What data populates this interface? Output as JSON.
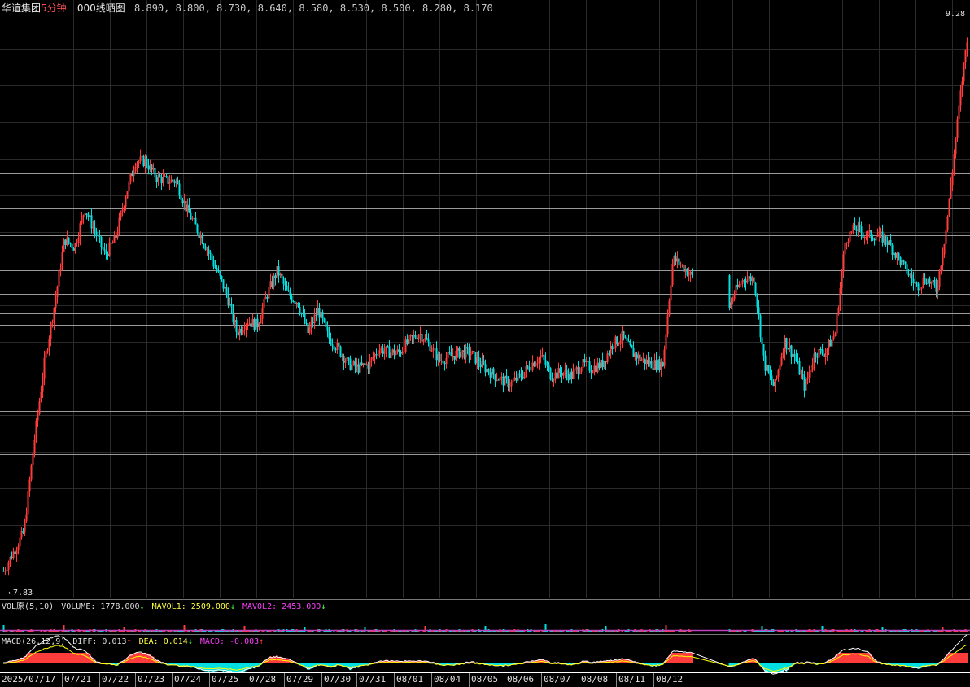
{
  "header": {
    "name": "华谊集团",
    "period": "5分钟",
    "indicator": "000线晒图",
    "levels": "8.890, 8.800, 8.730, 8.640, 8.580, 8.530, 8.500, 8.280, 8.170"
  },
  "price_labels": {
    "high": "9.28",
    "low": "←7.83"
  },
  "vol_legend": {
    "name": "VOL原(5,10)",
    "volume": "VOLUME: 1778.000",
    "volume_arrow": "↓",
    "mavol1": "MAVOL1: 2509.000",
    "mavol1_arrow": "↓",
    "mavol2": "MAVOL2: 2453.000",
    "mavol2_arrow": "↓"
  },
  "macd_legend": {
    "name": "MACD(26,12,9)",
    "diff": "DIFF: 0.013",
    "diff_arrow": "↑",
    "dea": "DEA: 0.014",
    "dea_arrow": "↓",
    "macd": "MACD: -0.003",
    "macd_arrow": "↑"
  },
  "dates": [
    "2025/07/17",
    "07/21",
    "07/22",
    "07/23",
    "07/24",
    "07/25",
    "07/28",
    "07/29",
    "07/30",
    "07/31",
    "08/01",
    "08/04",
    "08/05",
    "08/06",
    "08/07",
    "08/08",
    "08/11",
    "08/12"
  ],
  "colors": {
    "up": "#ff3c3c",
    "down": "#00e0e0",
    "grid": "#2a2a2a",
    "level_line": "#9a9a9a",
    "vol_line": "#c040c0",
    "diff_line": "#ffffff",
    "dea_line": "#ffff00"
  },
  "chart_data": {
    "type": "candlestick",
    "symbol": "华谊集团",
    "period": "5分钟",
    "y_high": 9.28,
    "y_low": 7.83,
    "ylim": [
      7.8,
      9.3
    ],
    "horizontal_levels": [
      8.89,
      8.8,
      8.73,
      8.64,
      8.58,
      8.53,
      8.5,
      8.28,
      8.17
    ],
    "date_labels": [
      "2025/07/17",
      "07/21",
      "07/22",
      "07/23",
      "07/24",
      "07/25",
      "07/28",
      "07/29",
      "07/30",
      "07/31",
      "08/01",
      "08/04",
      "08/05",
      "08/06",
      "08/07",
      "08/08",
      "08/11",
      "08/12"
    ],
    "close_path": [
      [
        0,
        7.87
      ],
      [
        1,
        7.92
      ],
      [
        2,
        7.97
      ],
      [
        3,
        8.2
      ],
      [
        4,
        8.4
      ],
      [
        5,
        8.55
      ],
      [
        6,
        8.72
      ],
      [
        7,
        8.7
      ],
      [
        8,
        8.8
      ],
      [
        9,
        8.74
      ],
      [
        10,
        8.68
      ],
      [
        11,
        8.72
      ],
      [
        12,
        8.83
      ],
      [
        13,
        8.92
      ],
      [
        14,
        8.92
      ],
      [
        15,
        8.88
      ],
      [
        16,
        8.87
      ],
      [
        17,
        8.87
      ],
      [
        18,
        8.8
      ],
      [
        19,
        8.75
      ],
      [
        20,
        8.7
      ],
      [
        21,
        8.64
      ],
      [
        22,
        8.58
      ],
      [
        23,
        8.48
      ],
      [
        24,
        8.51
      ],
      [
        25,
        8.5
      ],
      [
        26,
        8.58
      ],
      [
        27,
        8.64
      ],
      [
        28,
        8.58
      ],
      [
        29,
        8.56
      ],
      [
        30,
        8.48
      ],
      [
        31,
        8.54
      ],
      [
        32,
        8.47
      ],
      [
        33,
        8.44
      ],
      [
        34,
        8.4
      ],
      [
        35,
        8.39
      ],
      [
        36,
        8.4
      ],
      [
        37,
        8.44
      ],
      [
        38,
        8.43
      ],
      [
        39,
        8.43
      ],
      [
        40,
        8.46
      ],
      [
        41,
        8.48
      ],
      [
        42,
        8.45
      ],
      [
        43,
        8.41
      ],
      [
        44,
        8.42
      ],
      [
        45,
        8.43
      ],
      [
        46,
        8.43
      ],
      [
        47,
        8.4
      ],
      [
        48,
        8.38
      ],
      [
        49,
        8.36
      ],
      [
        50,
        8.35
      ],
      [
        51,
        8.37
      ],
      [
        52,
        8.4
      ],
      [
        53,
        8.42
      ],
      [
        54,
        8.37
      ],
      [
        55,
        8.38
      ],
      [
        56,
        8.37
      ],
      [
        57,
        8.4
      ],
      [
        58,
        8.39
      ],
      [
        59,
        8.4
      ],
      [
        60,
        8.45
      ],
      [
        61,
        8.47
      ],
      [
        62,
        8.43
      ],
      [
        63,
        8.41
      ],
      [
        64,
        8.4
      ],
      [
        65,
        8.4
      ],
      [
        66,
        8.67
      ],
      [
        67,
        8.65
      ],
      [
        68,
        8.62
      ],
      [
        69,
        8.66
      ],
      [
        70,
        8.58
      ],
      [
        71,
        8.5
      ],
      [
        72,
        8.58
      ],
      [
        73,
        8.62
      ],
      [
        74,
        8.62
      ],
      [
        75,
        8.4
      ],
      [
        76,
        8.34
      ],
      [
        77,
        8.46
      ],
      [
        78,
        8.42
      ],
      [
        79,
        8.34
      ],
      [
        80,
        8.43
      ],
      [
        81,
        8.43
      ],
      [
        82,
        8.48
      ],
      [
        83,
        8.72
      ],
      [
        84,
        8.75
      ],
      [
        85,
        8.73
      ],
      [
        86,
        8.73
      ],
      [
        87,
        8.72
      ],
      [
        88,
        8.68
      ],
      [
        89,
        8.64
      ],
      [
        90,
        8.6
      ],
      [
        91,
        8.62
      ],
      [
        92,
        8.59
      ],
      [
        93,
        8.76
      ],
      [
        94,
        9.01
      ],
      [
        95,
        9.24
      ]
    ],
    "series": [
      {
        "name": "VOL原(5,10)",
        "values": [
          1778.0
        ]
      },
      {
        "name": "MAVOL1",
        "values": [
          2509.0
        ]
      },
      {
        "name": "MAVOL2",
        "values": [
          2453.0
        ]
      },
      {
        "name": "DIFF",
        "values": [
          0.013
        ]
      },
      {
        "name": "DEA",
        "values": [
          0.014
        ]
      },
      {
        "name": "MACD",
        "values": [
          -0.003
        ]
      }
    ],
    "gap": [
      850,
      895
    ],
    "grid": true
  }
}
